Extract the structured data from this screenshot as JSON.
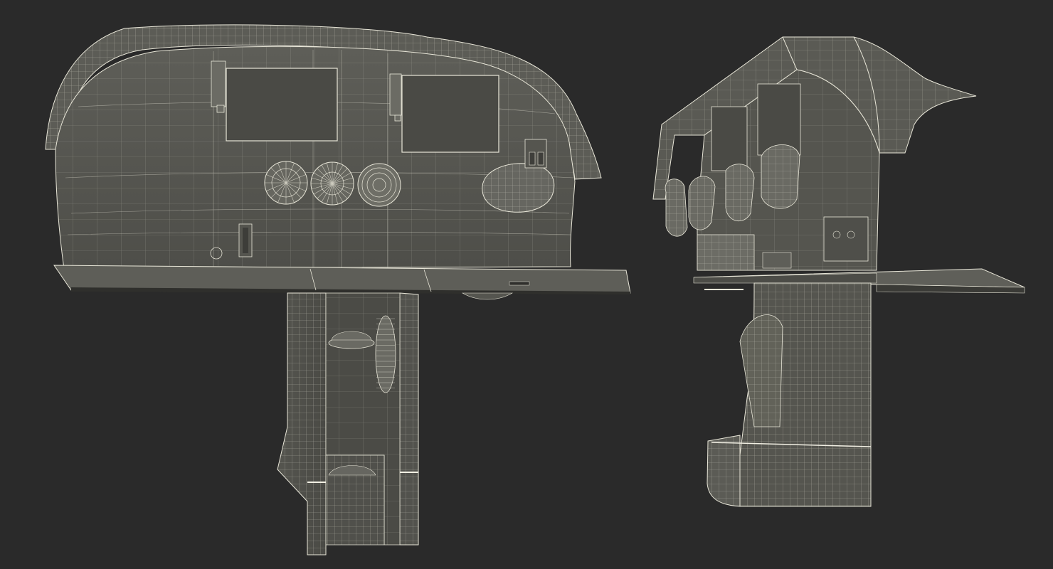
{
  "scene": {
    "background": "#2a2a2a",
    "subject": "wireframe-render-aircraft-cockpit-instrument-panel",
    "views": [
      "front",
      "side"
    ]
  },
  "palette": {
    "surface": "#595953",
    "surface_dark": "#45453f",
    "surface_light": "#6b6b64",
    "wire": "#e8e6d8",
    "screen": "#4a4a45",
    "shelf": "#5a5a55"
  }
}
